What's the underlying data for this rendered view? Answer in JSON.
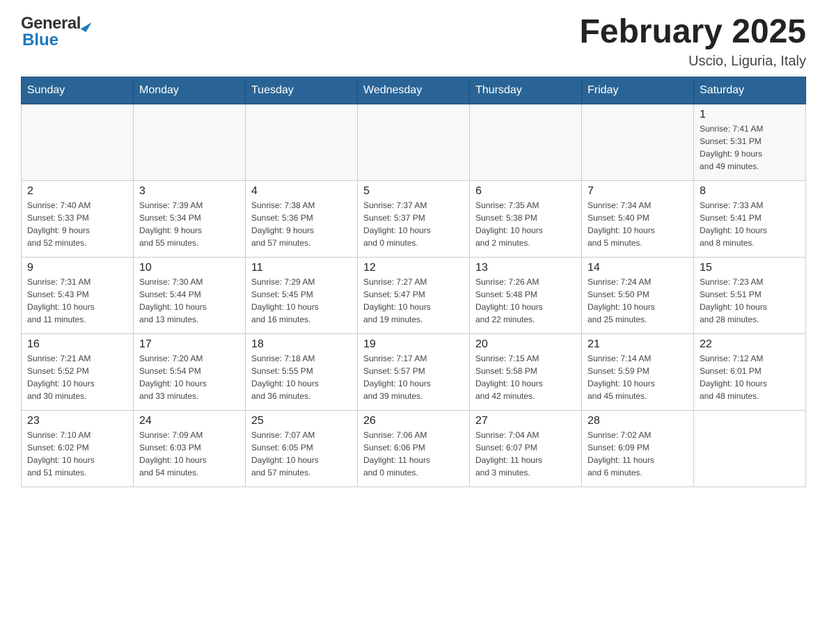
{
  "header": {
    "logo": {
      "general": "General",
      "arrow": "▶",
      "blue": "Blue"
    },
    "title": "February 2025",
    "location": "Uscio, Liguria, Italy"
  },
  "days_of_week": [
    "Sunday",
    "Monday",
    "Tuesday",
    "Wednesday",
    "Thursday",
    "Friday",
    "Saturday"
  ],
  "weeks": [
    [
      {
        "day": "",
        "info": ""
      },
      {
        "day": "",
        "info": ""
      },
      {
        "day": "",
        "info": ""
      },
      {
        "day": "",
        "info": ""
      },
      {
        "day": "",
        "info": ""
      },
      {
        "day": "",
        "info": ""
      },
      {
        "day": "1",
        "info": "Sunrise: 7:41 AM\nSunset: 5:31 PM\nDaylight: 9 hours\nand 49 minutes."
      }
    ],
    [
      {
        "day": "2",
        "info": "Sunrise: 7:40 AM\nSunset: 5:33 PM\nDaylight: 9 hours\nand 52 minutes."
      },
      {
        "day": "3",
        "info": "Sunrise: 7:39 AM\nSunset: 5:34 PM\nDaylight: 9 hours\nand 55 minutes."
      },
      {
        "day": "4",
        "info": "Sunrise: 7:38 AM\nSunset: 5:36 PM\nDaylight: 9 hours\nand 57 minutes."
      },
      {
        "day": "5",
        "info": "Sunrise: 7:37 AM\nSunset: 5:37 PM\nDaylight: 10 hours\nand 0 minutes."
      },
      {
        "day": "6",
        "info": "Sunrise: 7:35 AM\nSunset: 5:38 PM\nDaylight: 10 hours\nand 2 minutes."
      },
      {
        "day": "7",
        "info": "Sunrise: 7:34 AM\nSunset: 5:40 PM\nDaylight: 10 hours\nand 5 minutes."
      },
      {
        "day": "8",
        "info": "Sunrise: 7:33 AM\nSunset: 5:41 PM\nDaylight: 10 hours\nand 8 minutes."
      }
    ],
    [
      {
        "day": "9",
        "info": "Sunrise: 7:31 AM\nSunset: 5:43 PM\nDaylight: 10 hours\nand 11 minutes."
      },
      {
        "day": "10",
        "info": "Sunrise: 7:30 AM\nSunset: 5:44 PM\nDaylight: 10 hours\nand 13 minutes."
      },
      {
        "day": "11",
        "info": "Sunrise: 7:29 AM\nSunset: 5:45 PM\nDaylight: 10 hours\nand 16 minutes."
      },
      {
        "day": "12",
        "info": "Sunrise: 7:27 AM\nSunset: 5:47 PM\nDaylight: 10 hours\nand 19 minutes."
      },
      {
        "day": "13",
        "info": "Sunrise: 7:26 AM\nSunset: 5:48 PM\nDaylight: 10 hours\nand 22 minutes."
      },
      {
        "day": "14",
        "info": "Sunrise: 7:24 AM\nSunset: 5:50 PM\nDaylight: 10 hours\nand 25 minutes."
      },
      {
        "day": "15",
        "info": "Sunrise: 7:23 AM\nSunset: 5:51 PM\nDaylight: 10 hours\nand 28 minutes."
      }
    ],
    [
      {
        "day": "16",
        "info": "Sunrise: 7:21 AM\nSunset: 5:52 PM\nDaylight: 10 hours\nand 30 minutes."
      },
      {
        "day": "17",
        "info": "Sunrise: 7:20 AM\nSunset: 5:54 PM\nDaylight: 10 hours\nand 33 minutes."
      },
      {
        "day": "18",
        "info": "Sunrise: 7:18 AM\nSunset: 5:55 PM\nDaylight: 10 hours\nand 36 minutes."
      },
      {
        "day": "19",
        "info": "Sunrise: 7:17 AM\nSunset: 5:57 PM\nDaylight: 10 hours\nand 39 minutes."
      },
      {
        "day": "20",
        "info": "Sunrise: 7:15 AM\nSunset: 5:58 PM\nDaylight: 10 hours\nand 42 minutes."
      },
      {
        "day": "21",
        "info": "Sunrise: 7:14 AM\nSunset: 5:59 PM\nDaylight: 10 hours\nand 45 minutes."
      },
      {
        "day": "22",
        "info": "Sunrise: 7:12 AM\nSunset: 6:01 PM\nDaylight: 10 hours\nand 48 minutes."
      }
    ],
    [
      {
        "day": "23",
        "info": "Sunrise: 7:10 AM\nSunset: 6:02 PM\nDaylight: 10 hours\nand 51 minutes."
      },
      {
        "day": "24",
        "info": "Sunrise: 7:09 AM\nSunset: 6:03 PM\nDaylight: 10 hours\nand 54 minutes."
      },
      {
        "day": "25",
        "info": "Sunrise: 7:07 AM\nSunset: 6:05 PM\nDaylight: 10 hours\nand 57 minutes."
      },
      {
        "day": "26",
        "info": "Sunrise: 7:06 AM\nSunset: 6:06 PM\nDaylight: 11 hours\nand 0 minutes."
      },
      {
        "day": "27",
        "info": "Sunrise: 7:04 AM\nSunset: 6:07 PM\nDaylight: 11 hours\nand 3 minutes."
      },
      {
        "day": "28",
        "info": "Sunrise: 7:02 AM\nSunset: 6:09 PM\nDaylight: 11 hours\nand 6 minutes."
      },
      {
        "day": "",
        "info": ""
      }
    ]
  ]
}
